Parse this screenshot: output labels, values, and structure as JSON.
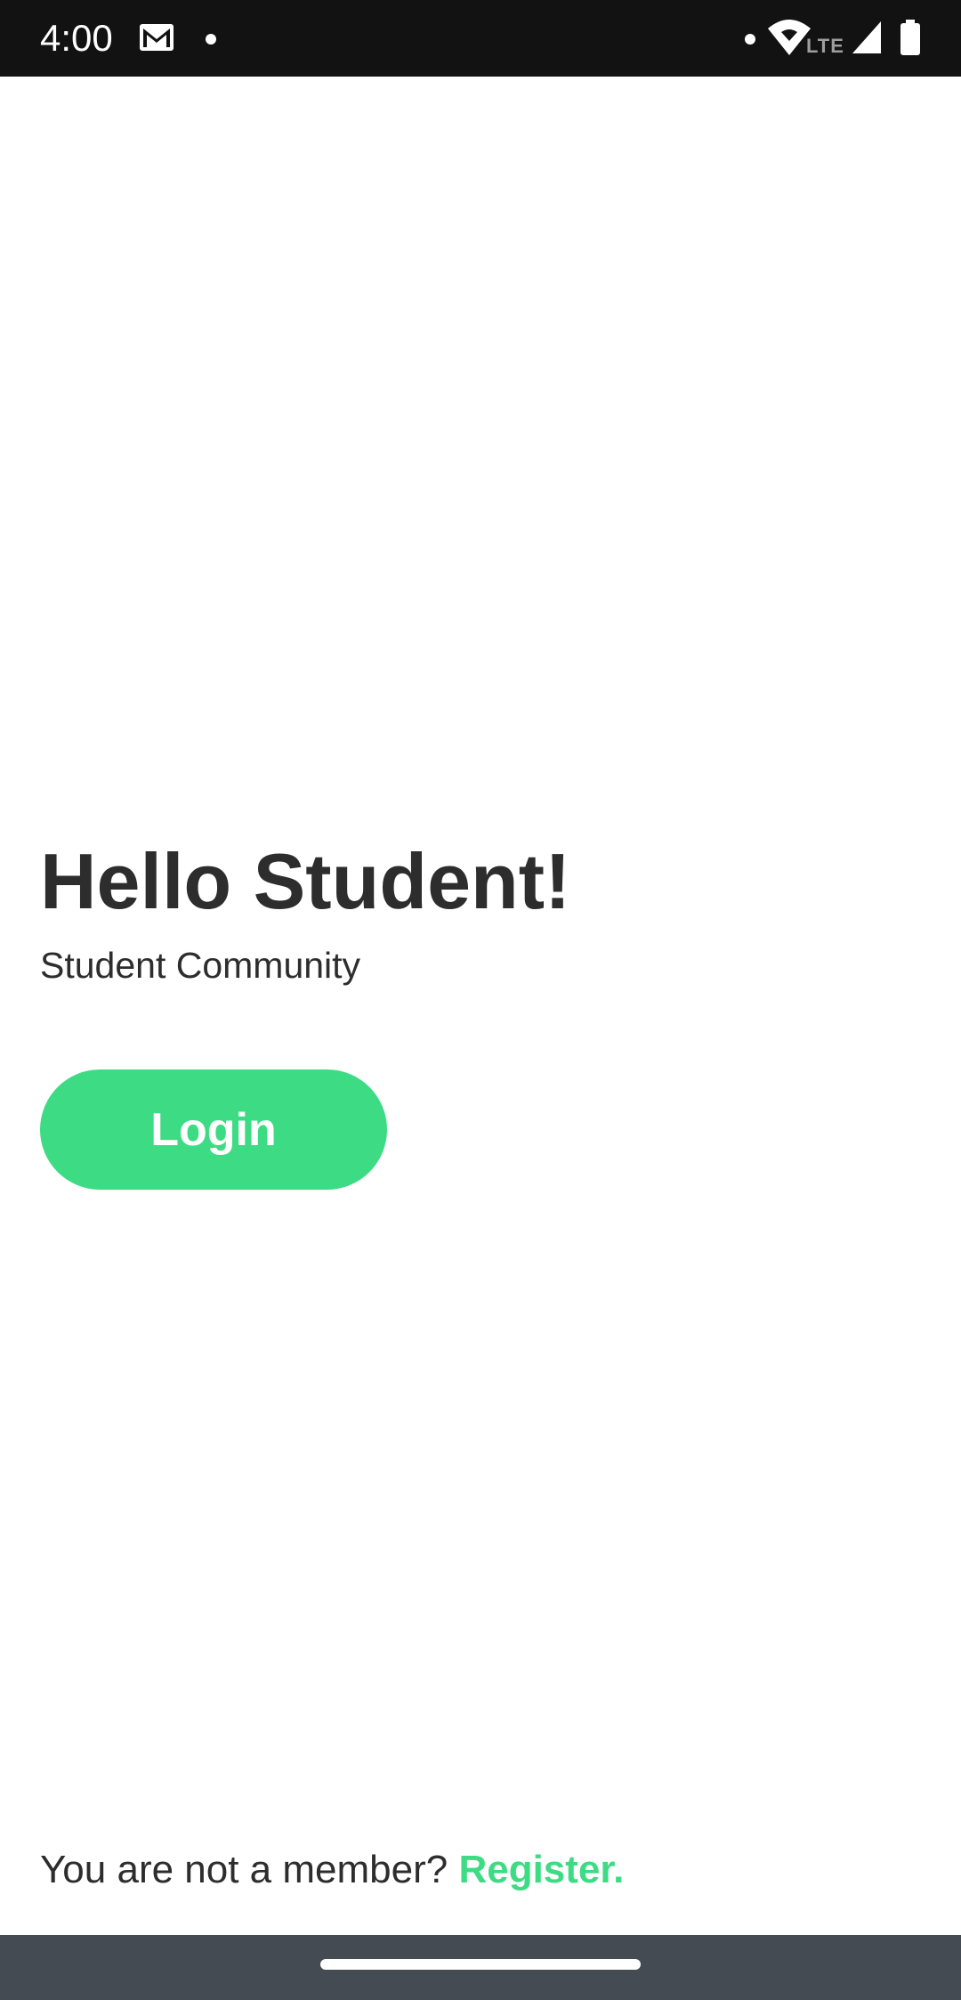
{
  "status_bar": {
    "time": "4:00",
    "network_label": "LTE",
    "icons": [
      "gmail-icon",
      "notification-dot",
      "wifi-icon",
      "signal-icon",
      "battery-icon"
    ]
  },
  "main": {
    "headline": "Hello Student!",
    "subtitle": "Student Community",
    "login_label": "Login"
  },
  "footer": {
    "prompt": "You are not a member? ",
    "register_label": "Register."
  },
  "colors": {
    "accent": "#3ddc84",
    "text": "#2d2d2d",
    "status_bar": "#121212",
    "nav_bar": "#454b52"
  }
}
